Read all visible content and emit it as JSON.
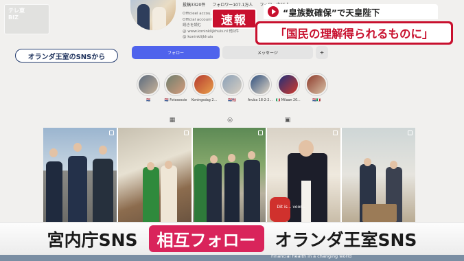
{
  "station_logo": "テレ東\nBIZ",
  "profile": {
    "stats": [
      "投稿3320件",
      "フォロワー107.1万人",
      "フォロー中55人"
    ],
    "bio": [
      "Officieel accou...",
      "Official account...",
      "続きを読む",
      "@ www.koninklijkhuis.nl 他1件",
      "@ koninklijkhuis"
    ]
  },
  "breaking": {
    "badge": "速報",
    "headline_top": "“皇族数確保”で天皇陛下",
    "headline_main": "「国民の理解得られるものに」"
  },
  "source_label": "オランダ王室のSNSから",
  "buttons": {
    "follow": "フォロー",
    "message": "メッセージ",
    "add": "+"
  },
  "highlights": [
    {
      "label": "­­­🇳🇱",
      "colors": [
        "#5b6a7d",
        "#c9b49a"
      ]
    },
    {
      "label": "🇳🇱 Fotosessie",
      "colors": [
        "#6f7f6e",
        "#d49b7c"
      ]
    },
    {
      "label": "Koningsdag 2...",
      "colors": [
        "#b53a2f",
        "#e8a04b"
      ]
    },
    {
      "label": "🇳🇱🇺🇸",
      "colors": [
        "#8aa0b8",
        "#d8cfc2"
      ]
    },
    {
      "label": "Aruba 18-2-2...",
      "colors": [
        "#2e4f7e",
        "#e2d7c6"
      ]
    },
    {
      "label": "🇮🇹 Milaan 20...",
      "colors": [
        "#1f2f7a",
        "#d23a2b"
      ]
    },
    {
      "label": "🇳🇱🇮🇹",
      "colors": [
        "#8e3b2c",
        "#d8c3a8"
      ]
    }
  ],
  "grid_caption": "Dit is... voor...",
  "telop": {
    "left": "宮内庁SNS",
    "middle": "相互フォロー",
    "right": "オランダ王室SNS"
  },
  "below_text": "Financial health in a changing world",
  "colors": {
    "accent_red": "#c8102e",
    "telop_pink": "#d9245b",
    "follow_blue": "#4f63ec"
  }
}
